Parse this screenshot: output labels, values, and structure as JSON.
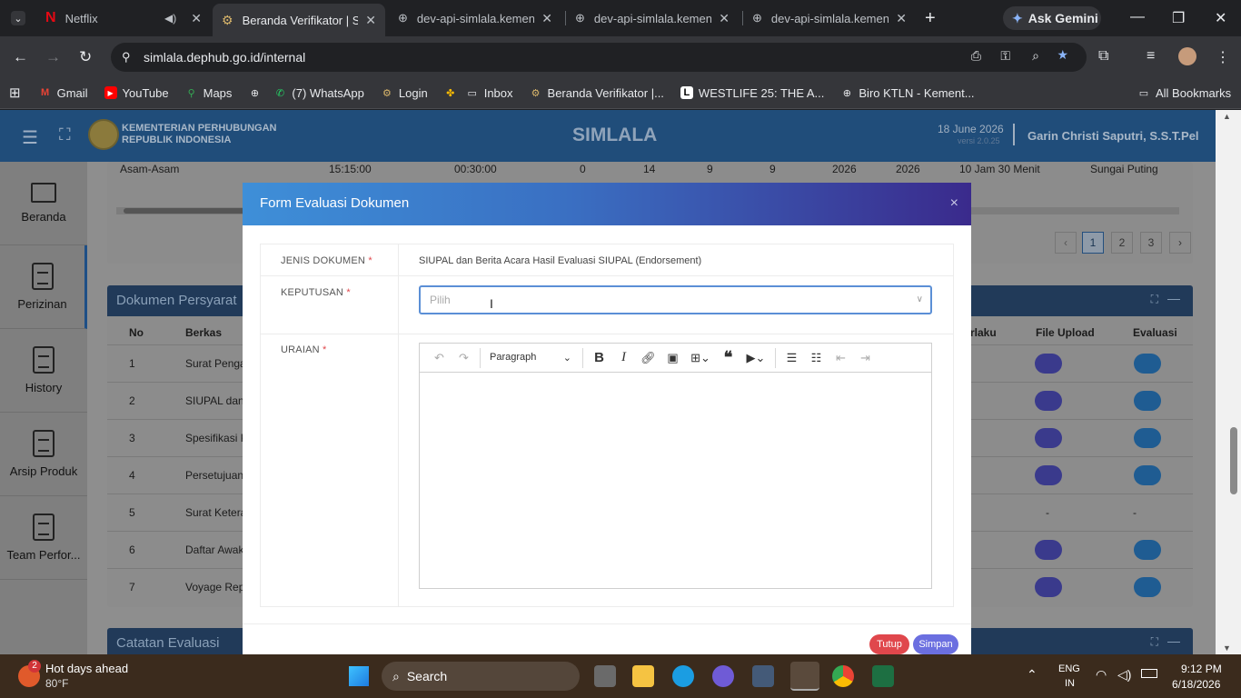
{
  "browser": {
    "tabs": [
      {
        "title": "Netflix"
      },
      {
        "title": "Beranda Verifikator | Si"
      },
      {
        "title": "dev-api-simlala.kemenh"
      },
      {
        "title": "dev-api-simlala.kemenh"
      },
      {
        "title": "dev-api-simlala.kemenh"
      }
    ],
    "ask_gemini": "Ask Gemini",
    "url": "simlala.dephub.go.id/internal",
    "bookmarks": [
      "Gmail",
      "YouTube",
      "Maps",
      "(7) WhatsApp",
      "Login",
      "Inbox",
      "Beranda Verifikator |...",
      "WESTLIFE 25: THE A...",
      "Biro KTLN - Kement..."
    ],
    "all_bookmarks": "All Bookmarks"
  },
  "app": {
    "ministry_line1": "KEMENTERIAN PERHUBUNGAN",
    "ministry_line2": "REPUBLIK INDONESIA",
    "name": "SIMLALA",
    "date": "18 June 2026",
    "version": "versi 2.0.25",
    "user": "Garin Christi Saputri, S.S.T.Pel"
  },
  "sidebar": [
    {
      "label": "Beranda"
    },
    {
      "label": "Perizinan"
    },
    {
      "label": "History"
    },
    {
      "label": "Arsip Produk"
    },
    {
      "label": "Team Perfor..."
    }
  ],
  "background": {
    "top_row": [
      "Asam-Asam",
      "15:15:00",
      "00:30:00",
      "0",
      "14",
      "9",
      "9",
      "2026",
      "2026",
      "10 Jam 30 Menit",
      "Sungai Puting"
    ],
    "pager": [
      "1",
      "2",
      "3"
    ],
    "dokumen_title": "Dokumen Persyarat",
    "headers": {
      "no": "No",
      "berkas": "Berkas",
      "berlaku": "rlaku",
      "file_upload": "File Upload",
      "evaluasi": "Evaluasi"
    },
    "rows": [
      {
        "no": "1",
        "berkas": "Surat Pengaj"
      },
      {
        "no": "2",
        "berkas": "SIUPAL dan E"
      },
      {
        "no": "3",
        "berkas": "Spesifikasi Ka"
      },
      {
        "no": "4",
        "berkas": "Persetujuan S"
      },
      {
        "no": "5",
        "berkas": "Surat Keterar"
      },
      {
        "no": "6",
        "berkas": "Daftar Awak"
      },
      {
        "no": "7",
        "berkas": "Voyage Repo"
      }
    ],
    "dash": "-",
    "catatan_title": "Catatan Evaluasi"
  },
  "modal": {
    "title": "Form Evaluasi Dokumen",
    "close": "×",
    "jenis_label": "JENIS DOKUMEN",
    "jenis_value": "SIUPAL dan Berita Acara Hasil Evaluasi SIUPAL (Endorsement)",
    "keputusan_label": "KEPUTUSAN",
    "keputusan_placeholder": "Pilih",
    "uraian_label": "URAIAN",
    "required_mark": "*",
    "paragraph_select": "Paragraph",
    "btn_tutup": "Tutup",
    "btn_simpan": "Simpan"
  },
  "taskbar": {
    "weather_title": "Hot days ahead",
    "weather_temp": "80°F",
    "notif_count": "2",
    "search": "Search",
    "lang1": "ENG",
    "lang2": "IN",
    "time": "9:12 PM",
    "date": "6/18/2026"
  }
}
